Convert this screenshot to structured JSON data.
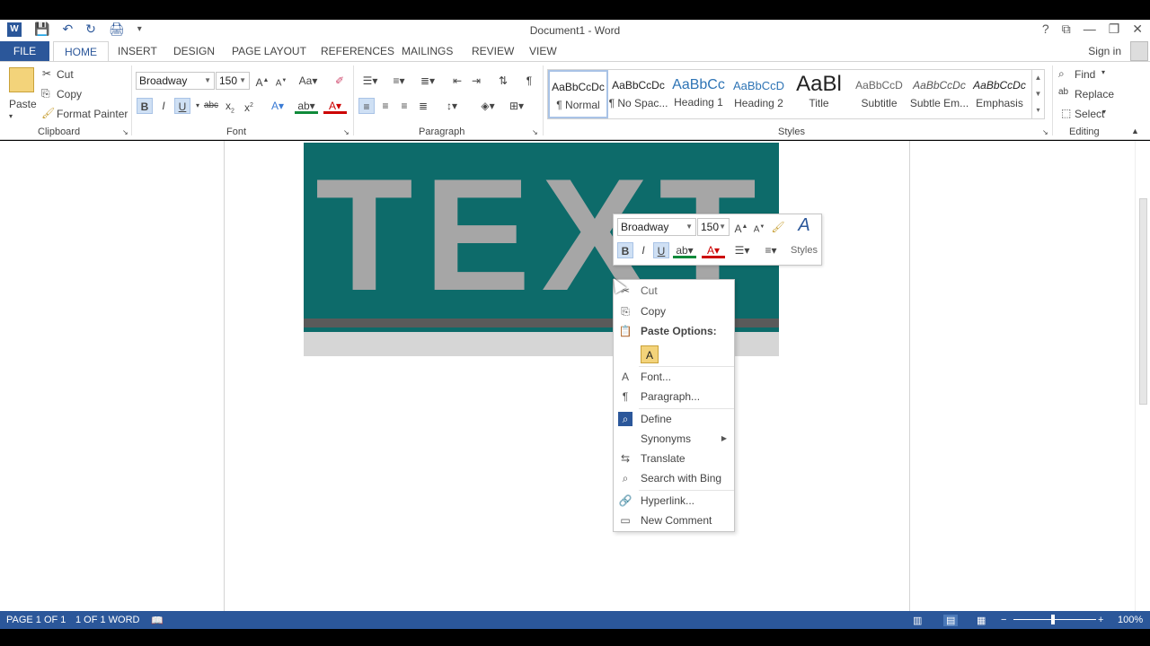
{
  "window": {
    "title": "Document1 - Word",
    "controls": {
      "help": "?",
      "ribbon_opts": "⧉",
      "minimize": "—",
      "restore": "❐",
      "close": "✕"
    }
  },
  "qat": {
    "save": "💾",
    "undo": "↶",
    "redo": "↻",
    "print": "🖨",
    "customize": "▾"
  },
  "tabs": [
    "FILE",
    "HOME",
    "INSERT",
    "DESIGN",
    "PAGE LAYOUT",
    "REFERENCES",
    "MAILINGS",
    "REVIEW",
    "VIEW"
  ],
  "account": {
    "sign_in": "Sign in"
  },
  "ribbon": {
    "clipboard": {
      "paste": "Paste",
      "cut": "Cut",
      "copy": "Copy",
      "format_painter": "Format Painter",
      "label": "Clipboard"
    },
    "font": {
      "name": "Broadway",
      "size": "150",
      "label": "Font"
    },
    "paragraph": {
      "label": "Paragraph"
    },
    "styles": {
      "label": "Styles",
      "items": [
        {
          "preview": "AaBbCcDc",
          "name": "¶ Normal"
        },
        {
          "preview": "AaBbCcDc",
          "name": "¶ No Spac..."
        },
        {
          "preview": "AaBbCc",
          "name": "Heading 1"
        },
        {
          "preview": "AaBbCcD",
          "name": "Heading 2"
        },
        {
          "preview": "AaBl",
          "name": "Title"
        },
        {
          "preview": "AaBbCcD",
          "name": "Subtitle"
        },
        {
          "preview": "AaBbCcDc",
          "name": "Subtle Em..."
        },
        {
          "preview": "AaBbCcDc",
          "name": "Emphasis"
        }
      ]
    },
    "editing": {
      "find": "Find",
      "replace": "Replace",
      "select": "Select",
      "label": "Editing"
    }
  },
  "document": {
    "text": "TEXT"
  },
  "mini_toolbar": {
    "font": "Broadway",
    "size": "150",
    "styles": "Styles"
  },
  "context_menu": {
    "cut": "Cut",
    "copy": "Copy",
    "paste_options": "Paste Options:",
    "font": "Font...",
    "paragraph": "Paragraph...",
    "define": "Define",
    "synonyms": "Synonyms",
    "translate": "Translate",
    "search_bing": "Search with Bing",
    "hyperlink": "Hyperlink...",
    "new_comment": "New Comment"
  },
  "status": {
    "page": "PAGE 1 OF 1",
    "words": "1 OF 1 WORD",
    "zoom": "100%"
  },
  "colors": {
    "accent": "#2b579a",
    "canvas_fill": "#0d6b6a",
    "text_gray": "#a6a6a6"
  }
}
